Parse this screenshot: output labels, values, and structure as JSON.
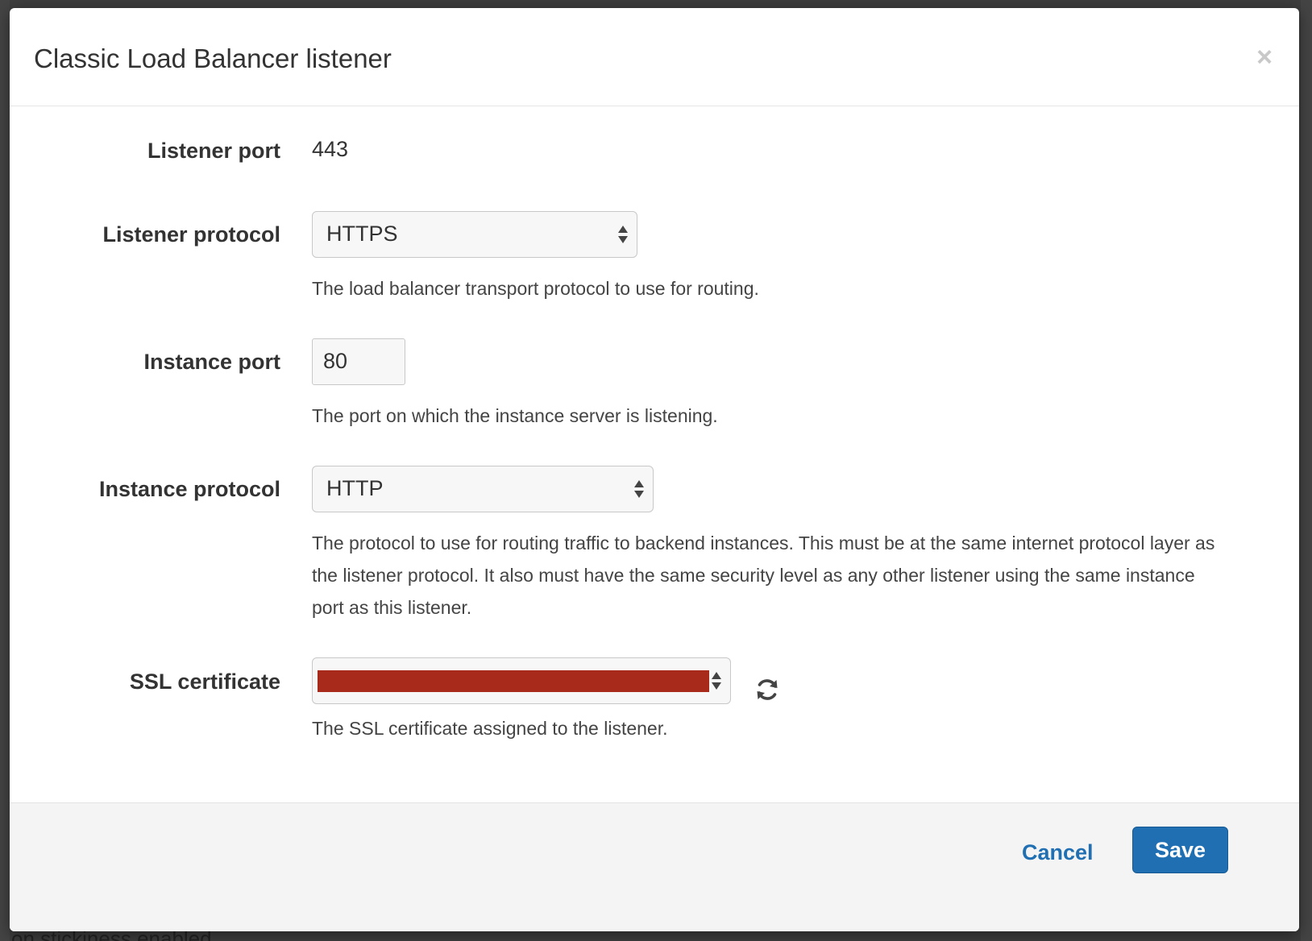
{
  "modal": {
    "title": "Classic Load Balancer listener",
    "close_glyph": "×"
  },
  "fields": {
    "listener_port": {
      "label": "Listener port",
      "value": "443"
    },
    "listener_protocol": {
      "label": "Listener protocol",
      "selected": "HTTPS",
      "help": "The load balancer transport protocol to use for routing."
    },
    "instance_port": {
      "label": "Instance port",
      "value": "80",
      "help": "The port on which the instance server is listening."
    },
    "instance_protocol": {
      "label": "Instance protocol",
      "selected": "HTTP",
      "help": "The protocol to use for routing traffic to backend instances. This must be at the same internet protocol layer as the listener protocol. It also must have the same security level as any other listener using the same instance port as this listener."
    },
    "ssl_certificate": {
      "label": "SSL certificate",
      "help": "The SSL certificate assigned to the listener.",
      "refresh_icon": "refresh-icon"
    }
  },
  "footer": {
    "cancel_label": "Cancel",
    "save_label": "Save"
  },
  "background": {
    "bottom_text": "on stickiness enabled"
  },
  "colors": {
    "primary": "#1f6fb2",
    "redaction": "#a82a1a"
  }
}
